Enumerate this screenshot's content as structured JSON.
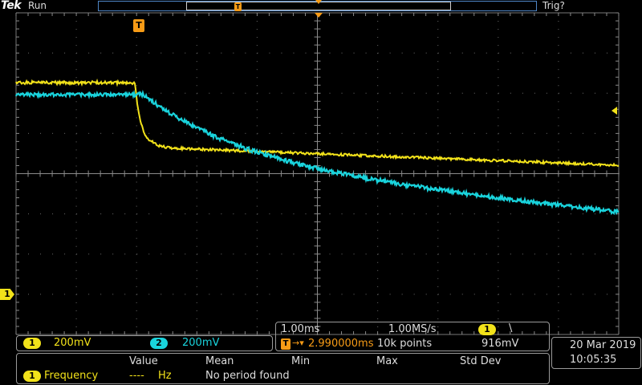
{
  "header": {
    "brand": "Tek",
    "run_state": "Run",
    "trigger_state": "Trig?",
    "trigger_marker_label": "T"
  },
  "screen": {
    "trigger_position_label": "T",
    "ch1_ground_marker": "1"
  },
  "channels": [
    {
      "number": "1",
      "scale": "200mV",
      "color": "#f2e21a"
    },
    {
      "number": "2",
      "scale": "200mV",
      "color": "#19d3dc"
    }
  ],
  "timebase": {
    "scale": "1.00ms",
    "sample_rate": "1.00MS/s",
    "delay_icon": "T",
    "delay": "2.990000ms",
    "record_length": "10k points",
    "trigger_source": "1",
    "trigger_slope_glyph": "\\",
    "trigger_level": "916mV"
  },
  "datetime": {
    "date": "20 Mar  2019",
    "time": "10:05:35"
  },
  "measurements": {
    "headers": [
      "Value",
      "Mean",
      "Min",
      "Max",
      "Std Dev"
    ],
    "rows": [
      {
        "channel": "1",
        "name": "Frequency",
        "value": "----",
        "unit": "Hz",
        "status": "No period found"
      }
    ]
  },
  "colors": {
    "ch1": "#f2e21a",
    "ch2": "#19d3dc",
    "trigger": "#f79b16",
    "grid": "#5a5a5a",
    "panel_border": "#9a9a9a"
  }
}
